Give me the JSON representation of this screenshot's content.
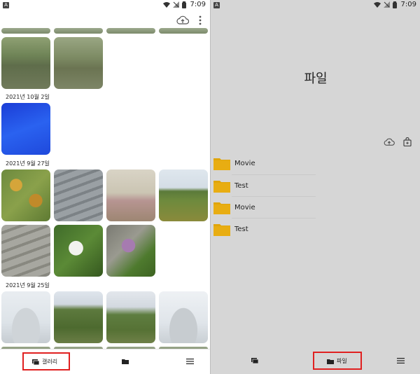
{
  "status_bar": {
    "app_badge": "A",
    "time": "7:09",
    "icons": [
      "wifi-icon",
      "signal-icon",
      "battery-icon"
    ]
  },
  "gallery": {
    "toolbar_icons": [
      "cloud-upload-icon",
      "more-vert-icon"
    ],
    "sections": [
      {
        "date": "2021년 10월 2일"
      },
      {
        "date": "2021년 9월 27일"
      },
      {
        "date": "2021년 9월 25일"
      }
    ],
    "bottom_nav": {
      "gallery_label": "갤러리",
      "items": [
        "gallery-icon",
        "folder-icon",
        "menu-icon"
      ]
    }
  },
  "files": {
    "title": "파일",
    "action_icons": [
      "cloud-upload-icon",
      "lock-add-icon"
    ],
    "folders": [
      {
        "name": "Movie"
      },
      {
        "name": "Test"
      },
      {
        "name": "Movie"
      },
      {
        "name": "Test"
      }
    ],
    "bottom_nav": {
      "files_label": "파일",
      "items": [
        "gallery-icon",
        "folder-icon",
        "menu-icon"
      ]
    }
  },
  "colors": {
    "folder": "#e0a50a",
    "highlight": "#e02020",
    "files_bg": "#d6d6d6"
  }
}
